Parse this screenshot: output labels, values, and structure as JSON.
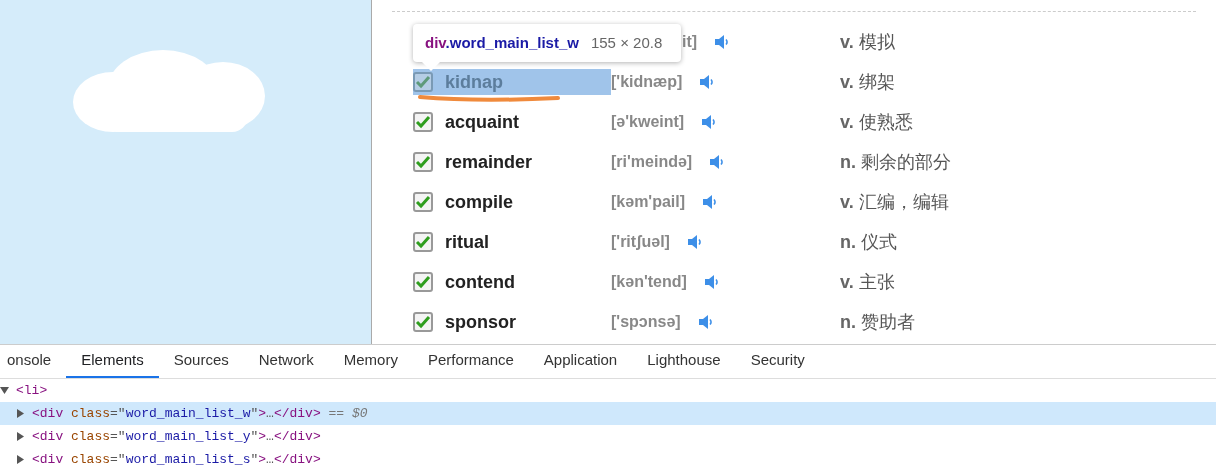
{
  "page": {
    "rows": [
      {
        "phonetic": "it]",
        "pos": "v.",
        "meaning": "模拟"
      },
      {
        "checked": true,
        "selected": true,
        "word": "kidnap",
        "phonetic": "['kidnæp]",
        "pos": "v.",
        "meaning": "绑架"
      },
      {
        "checked": true,
        "selected": false,
        "word": "acquaint",
        "phonetic": "[ə'kweint]",
        "pos": "v.",
        "meaning": "使熟悉"
      },
      {
        "checked": true,
        "selected": false,
        "word": "remainder",
        "phonetic": "[ri'meində]",
        "pos": "n.",
        "meaning": "剩余的部分"
      },
      {
        "checked": true,
        "selected": false,
        "word": "compile",
        "phonetic": "[kəm'pail]",
        "pos": "v.",
        "meaning": "汇编，编辑"
      },
      {
        "checked": true,
        "selected": false,
        "word": "ritual",
        "phonetic": "['ritʃuəl]",
        "pos": "n.",
        "meaning": "仪式"
      },
      {
        "checked": true,
        "selected": false,
        "word": "contend",
        "phonetic": "[kən'tend]",
        "pos": "v.",
        "meaning": "主张"
      },
      {
        "checked": true,
        "selected": false,
        "word": "sponsor",
        "phonetic": "['spɔnsə]",
        "pos": "n.",
        "meaning": "赞助者"
      }
    ]
  },
  "tooltip": {
    "tag": "div",
    "class": ".word_main_list_w",
    "size": "155 × 20.8"
  },
  "devtools": {
    "tabs": [
      {
        "label": "onsole",
        "selected": false
      },
      {
        "label": "Elements",
        "selected": true
      },
      {
        "label": "Sources",
        "selected": false
      },
      {
        "label": "Network",
        "selected": false
      },
      {
        "label": "Memory",
        "selected": false
      },
      {
        "label": "Performance",
        "selected": false
      },
      {
        "label": "Application",
        "selected": false
      },
      {
        "label": "Lighthouse",
        "selected": false
      },
      {
        "label": "Security",
        "selected": false
      }
    ],
    "tree": [
      {
        "expanded": true,
        "selected": false,
        "tokens": [
          {
            "kind": "tag",
            "text": "<li>"
          }
        ],
        "children": [
          {
            "expanded": false,
            "selected": true,
            "suffix": "== $0",
            "tokens": [
              {
                "kind": "tag",
                "text": "<div"
              },
              {
                "kind": "attr",
                "text": " class"
              },
              {
                "kind": "punct",
                "text": "=\""
              },
              {
                "kind": "value",
                "text": "word_main_list_w"
              },
              {
                "kind": "punct",
                "text": "\""
              },
              {
                "kind": "tag",
                "text": ">"
              },
              {
                "kind": "punct",
                "text": "…"
              },
              {
                "kind": "tag",
                "text": "</div>"
              }
            ]
          },
          {
            "expanded": false,
            "selected": false,
            "tokens": [
              {
                "kind": "tag",
                "text": "<div"
              },
              {
                "kind": "attr",
                "text": " class"
              },
              {
                "kind": "punct",
                "text": "=\""
              },
              {
                "kind": "value",
                "text": "word_main_list_y"
              },
              {
                "kind": "punct",
                "text": "\""
              },
              {
                "kind": "tag",
                "text": ">"
              },
              {
                "kind": "punct",
                "text": "…"
              },
              {
                "kind": "tag",
                "text": "</div>"
              }
            ]
          },
          {
            "expanded": false,
            "selected": false,
            "tokens": [
              {
                "kind": "tag",
                "text": "<div"
              },
              {
                "kind": "attr",
                "text": " class"
              },
              {
                "kind": "punct",
                "text": "=\""
              },
              {
                "kind": "value",
                "text": "word_main_list_s"
              },
              {
                "kind": "punct",
                "text": "\""
              },
              {
                "kind": "tag",
                "text": ">"
              },
              {
                "kind": "punct",
                "text": "…"
              },
              {
                "kind": "tag",
                "text": "</div>"
              }
            ]
          }
        ]
      }
    ]
  }
}
